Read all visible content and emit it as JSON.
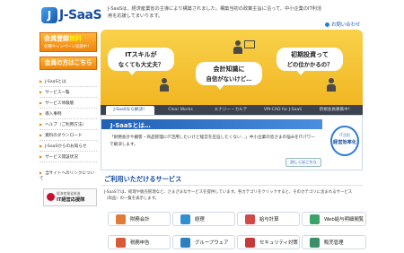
{
  "header": {
    "logo_mark": "J",
    "logo_text": "J-SaaS",
    "tagline": "J-SaaSは、経済産業省の主導により構築されました。構築当初の政策主旨に沿って、中小企業のIT利活用を応援してまいります。",
    "contact": "お問い合わせ"
  },
  "sidebar": {
    "promo_register_main": "会員登録",
    "promo_register_free": "無料",
    "promo_register_sub": "各種キャンペーン実施中！",
    "promo_member": "会員の方はこちら",
    "items": [
      "J-SaaSとは",
      "サービス一覧",
      "サービス体験版",
      "導入事例",
      "ヘルプ（ご利用方法）",
      "資料のダウンロード",
      "J-SaaSからのお知らせ",
      "サービス開設状況"
    ],
    "site_link": "当サイトへのリンクについて",
    "banner_small": "経済産業省推進",
    "banner_main": "IT経営応援隊"
  },
  "hero": {
    "bubble_1_line1": "ITスキルが",
    "bubble_1_line2": "なくても大丈夫？",
    "bubble_2_line1": "会計知識に",
    "bubble_2_line2": "自信がないけど…",
    "bubble_3_line1": "初期投資って",
    "bubble_3_line2": "どの位かかるの？"
  },
  "tabs": [
    "J-SaaSなら解決！",
    "Clear Works",
    "エナジー・カルテ",
    "VM-CAD for J-SaaS",
    "新規会員募集中！"
  ],
  "intro": {
    "title": "J-SaaSとは…",
    "body": "「財務会計や顧客・商品管理にIT活用したいけど経営を圧迫したくない…」中小企業の皆さまの悩みをITパワーで解決します。",
    "more": "詳しくはこちら",
    "badge_top": "IT活用",
    "badge_main": "経営効率化"
  },
  "services": {
    "title": "ご利用いただけるサービス",
    "desc": "J-SaaSでは、経理や販売管理など、さまざまなサービスを提供しています。各カテゴリをクリックすると、そのカテゴリに含まれるサービス（商品）の一覧を表示します。",
    "items": [
      {
        "label": "財務会計",
        "color": "#e07b3a"
      },
      {
        "label": "経理",
        "color": "#2f8fd0"
      },
      {
        "label": "給与計算",
        "color": "#d04a4a"
      },
      {
        "label": "Web給与明細閲覧",
        "color": "#3aa36a"
      },
      {
        "label": "税務申告",
        "color": "#d85a3a"
      },
      {
        "label": "グループウェア",
        "color": "#2c7fc1"
      },
      {
        "label": "セキュリティ対策",
        "color": "#c43a3a"
      },
      {
        "label": "販売管理",
        "color": "#3a8f6a"
      }
    ]
  }
}
